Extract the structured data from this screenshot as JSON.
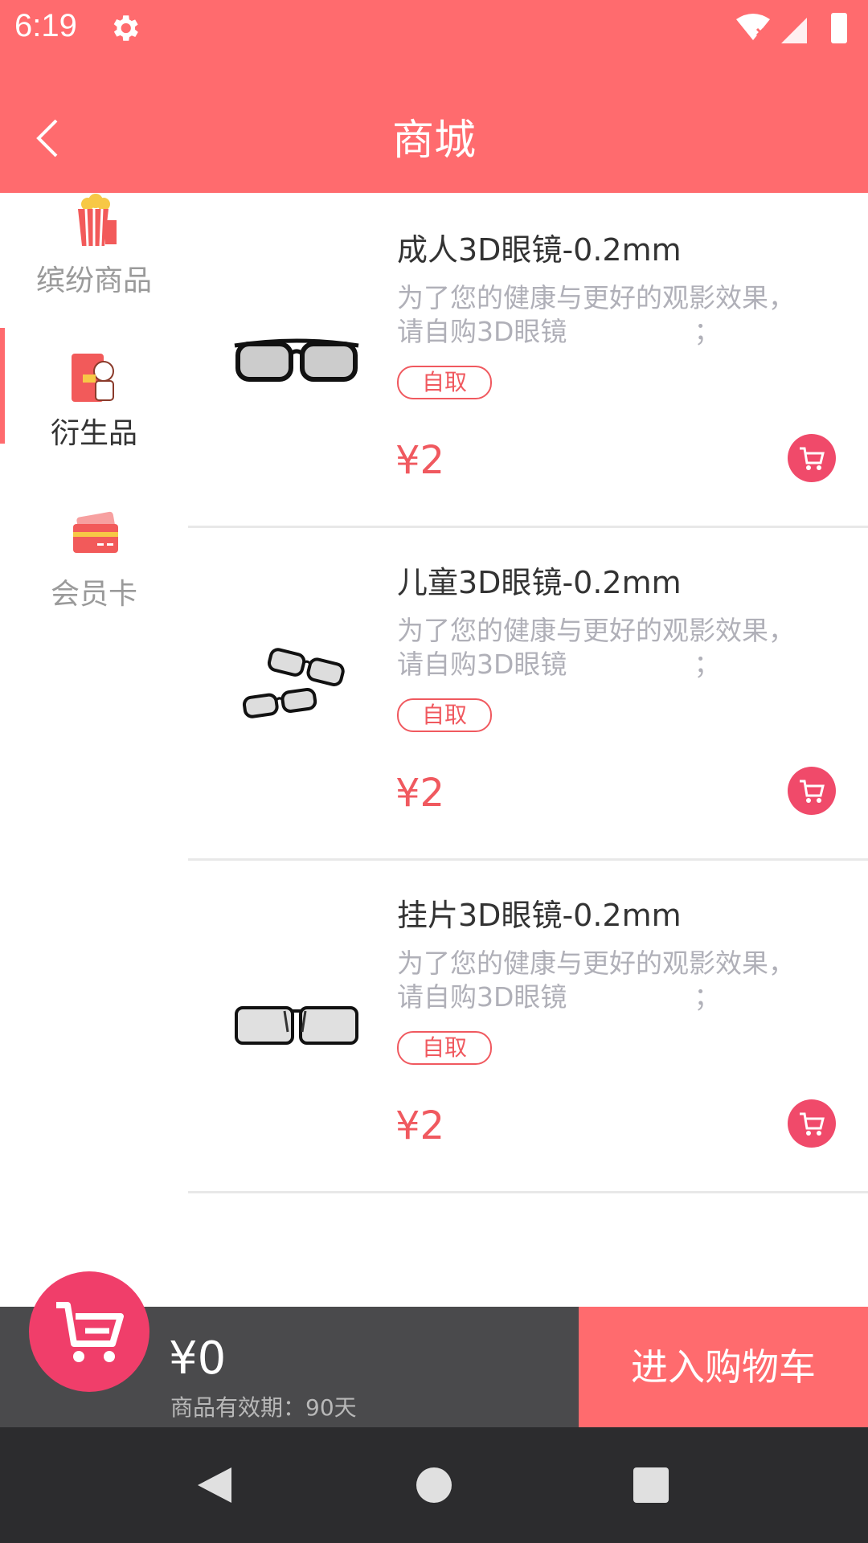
{
  "status": {
    "time": "6:19"
  },
  "header": {
    "title": "商城"
  },
  "sidebar": {
    "items": [
      {
        "label": "缤纷商品",
        "icon": "popcorn-icon"
      },
      {
        "label": "衍生品",
        "icon": "merchandise-icon"
      },
      {
        "label": "会员卡",
        "icon": "member-card-icon"
      }
    ],
    "active_index": 1
  },
  "products": [
    {
      "name": "成人3D眼镜-0.2mm",
      "desc_line1": "为了您的健康与更好的观影效果，",
      "desc_line2": "请自购3D眼镜",
      "desc_tail": "；",
      "tag": "自取",
      "price": "¥2",
      "image": "adult-3d-glasses"
    },
    {
      "name": "儿童3D眼镜-0.2mm",
      "desc_line1": "为了您的健康与更好的观影效果，",
      "desc_line2": "请自购3D眼镜",
      "desc_tail": "；",
      "tag": "自取",
      "price": "¥2",
      "image": "kids-3d-glasses"
    },
    {
      "name": "挂片3D眼镜-0.2mm",
      "desc_line1": "为了您的健康与更好的观影效果，",
      "desc_line2": "请自购3D眼镜",
      "desc_tail": "；",
      "tag": "自取",
      "price": "¥2",
      "image": "clip-on-3d-glasses"
    }
  ],
  "cart": {
    "total": "¥0",
    "validity": "商品有效期：90天",
    "checkout_label": "进入购物车"
  },
  "colors": {
    "accent": "#ff6b6e",
    "price": "#f0595f",
    "cart_button": "#f04a6a",
    "cart_bar": "#4a4a4c",
    "nav_bar": "#2c2c2e"
  }
}
